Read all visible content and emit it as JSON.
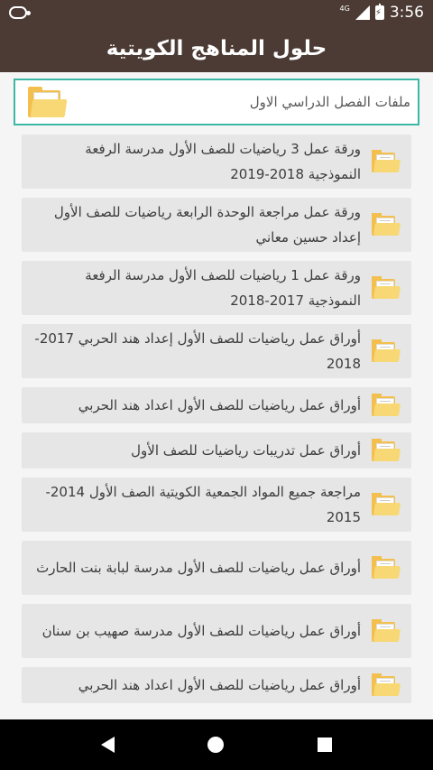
{
  "status_bar": {
    "network": "4G",
    "time": "3:56"
  },
  "app_bar": {
    "title": "حلول المناهج الكويتية"
  },
  "section_header": {
    "label": "ملفات الفصل الدراسي الاول",
    "icon": "folder-icon"
  },
  "files": [
    {
      "label": "ورقة عمل 3 رياضيات للصف الأول مدرسة الرفعة النموذجية 2018-2019",
      "icon": "folder-icon"
    },
    {
      "label": "ورقة عمل مراجعة الوحدة الرابعة رياضيات للصف الأول إعداد حسين معاني",
      "icon": "folder-icon"
    },
    {
      "label": "ورقة عمل 1 رياضيات للصف الأول مدرسة الرفعة النموذجية 2017-2018",
      "icon": "folder-icon"
    },
    {
      "label": "أوراق عمل رياضيات للصف الأول إعداد هند الحربي 2017-2018",
      "icon": "folder-icon"
    },
    {
      "label": "أوراق عمل رياضيات للصف الأول اعداد هند الحربي",
      "icon": "folder-icon"
    },
    {
      "label": "أوراق عمل تدريبات رياضيات للصف الأول",
      "icon": "folder-icon"
    },
    {
      "label": "مراجعة جميع المواد الجمعية الكويتية الصف الأول 2014-2015",
      "icon": "folder-icon"
    },
    {
      "label": "أوراق عمل رياضيات للصف الأول مدرسة لبابة بنت الحارث",
      "icon": "folder-icon"
    },
    {
      "label": "أوراق عمل رياضيات للصف الأول مدرسة صهيب بن سنان",
      "icon": "folder-icon"
    },
    {
      "label": "أوراق عمل رياضيات للصف الأول اعداد هند الحربي",
      "icon": "folder-icon"
    }
  ],
  "colors": {
    "app_bar": "#4b3b34",
    "accent": "#3cb7a4",
    "item_bg": "#e6e6e6",
    "folder": "#f3c04f"
  }
}
